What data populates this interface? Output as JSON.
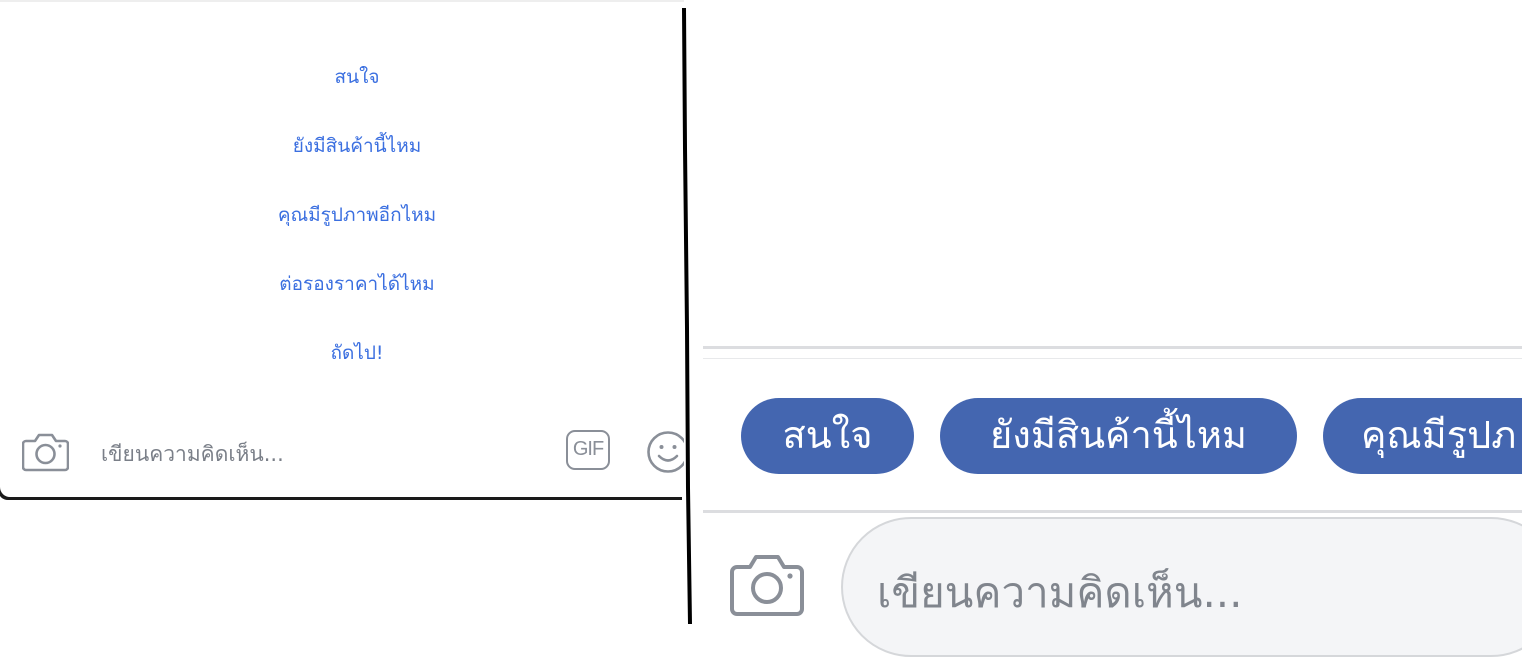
{
  "left_panel": {
    "suggestions": [
      {
        "label": "สนใจ"
      },
      {
        "label": "ยังมีสินค้านี้ไหม"
      },
      {
        "label": "คุณมีรูปภาพอีกไหม"
      },
      {
        "label": "ต่อรองราคาได้ไหม"
      },
      {
        "label": "ถัดไป!"
      }
    ],
    "comment": {
      "placeholder": "เขียนความคิดเห็น...",
      "camera_icon": "camera-icon",
      "gif_label": "GIF",
      "emoji_icon": "smiley-icon"
    }
  },
  "right_panel": {
    "chips": [
      {
        "label": "สนใจ"
      },
      {
        "label": "ยังมีสินค้านี้ไหม"
      },
      {
        "label": "คุณมีรูปภ"
      }
    ],
    "comment": {
      "placeholder": "เขียนความคิดเห็น...",
      "camera_icon": "camera-icon"
    }
  },
  "colors": {
    "suggestion_text": "#3b6fe0",
    "chip_background": "#4466b0",
    "chip_text": "#ffffff",
    "placeholder_text": "#7a7f88",
    "icon_gray": "#8a8f98"
  }
}
